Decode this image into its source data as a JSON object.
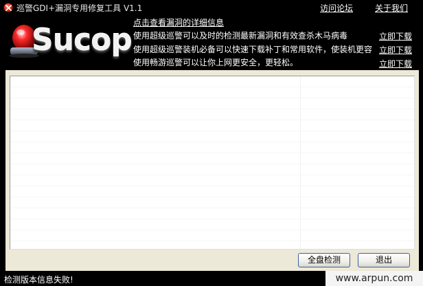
{
  "window": {
    "title": "巡警GDI+漏洞专用修复工具 V1.1",
    "links": {
      "forum": "访问论坛",
      "about": "关于我们"
    }
  },
  "header": {
    "logo_text": "Sucop",
    "info_title": "点击查看漏洞的详细信息",
    "lines": [
      {
        "text": "使用超级巡警可以及时的检测最新漏洞和有效查杀木马病毒",
        "link": "立即下载"
      },
      {
        "text": "使用超级巡警装机必备可以快速下载补丁和常用软件，使装机更容",
        "link": "立即下载"
      },
      {
        "text": "使用畅游巡警可以让你上网更安全，更轻松。",
        "link": "立即下载"
      }
    ]
  },
  "buttons": {
    "scan": "全盘检测",
    "exit": "退出"
  },
  "status": {
    "text": "检测版本信息失败!"
  },
  "watermark": "www.arpun.com",
  "colors": {
    "background": "#000000",
    "panel": "#ece9d8",
    "button_border": "#3a5ea8"
  },
  "icons": {
    "app": "error-x-icon",
    "logo": "siren-icon"
  }
}
